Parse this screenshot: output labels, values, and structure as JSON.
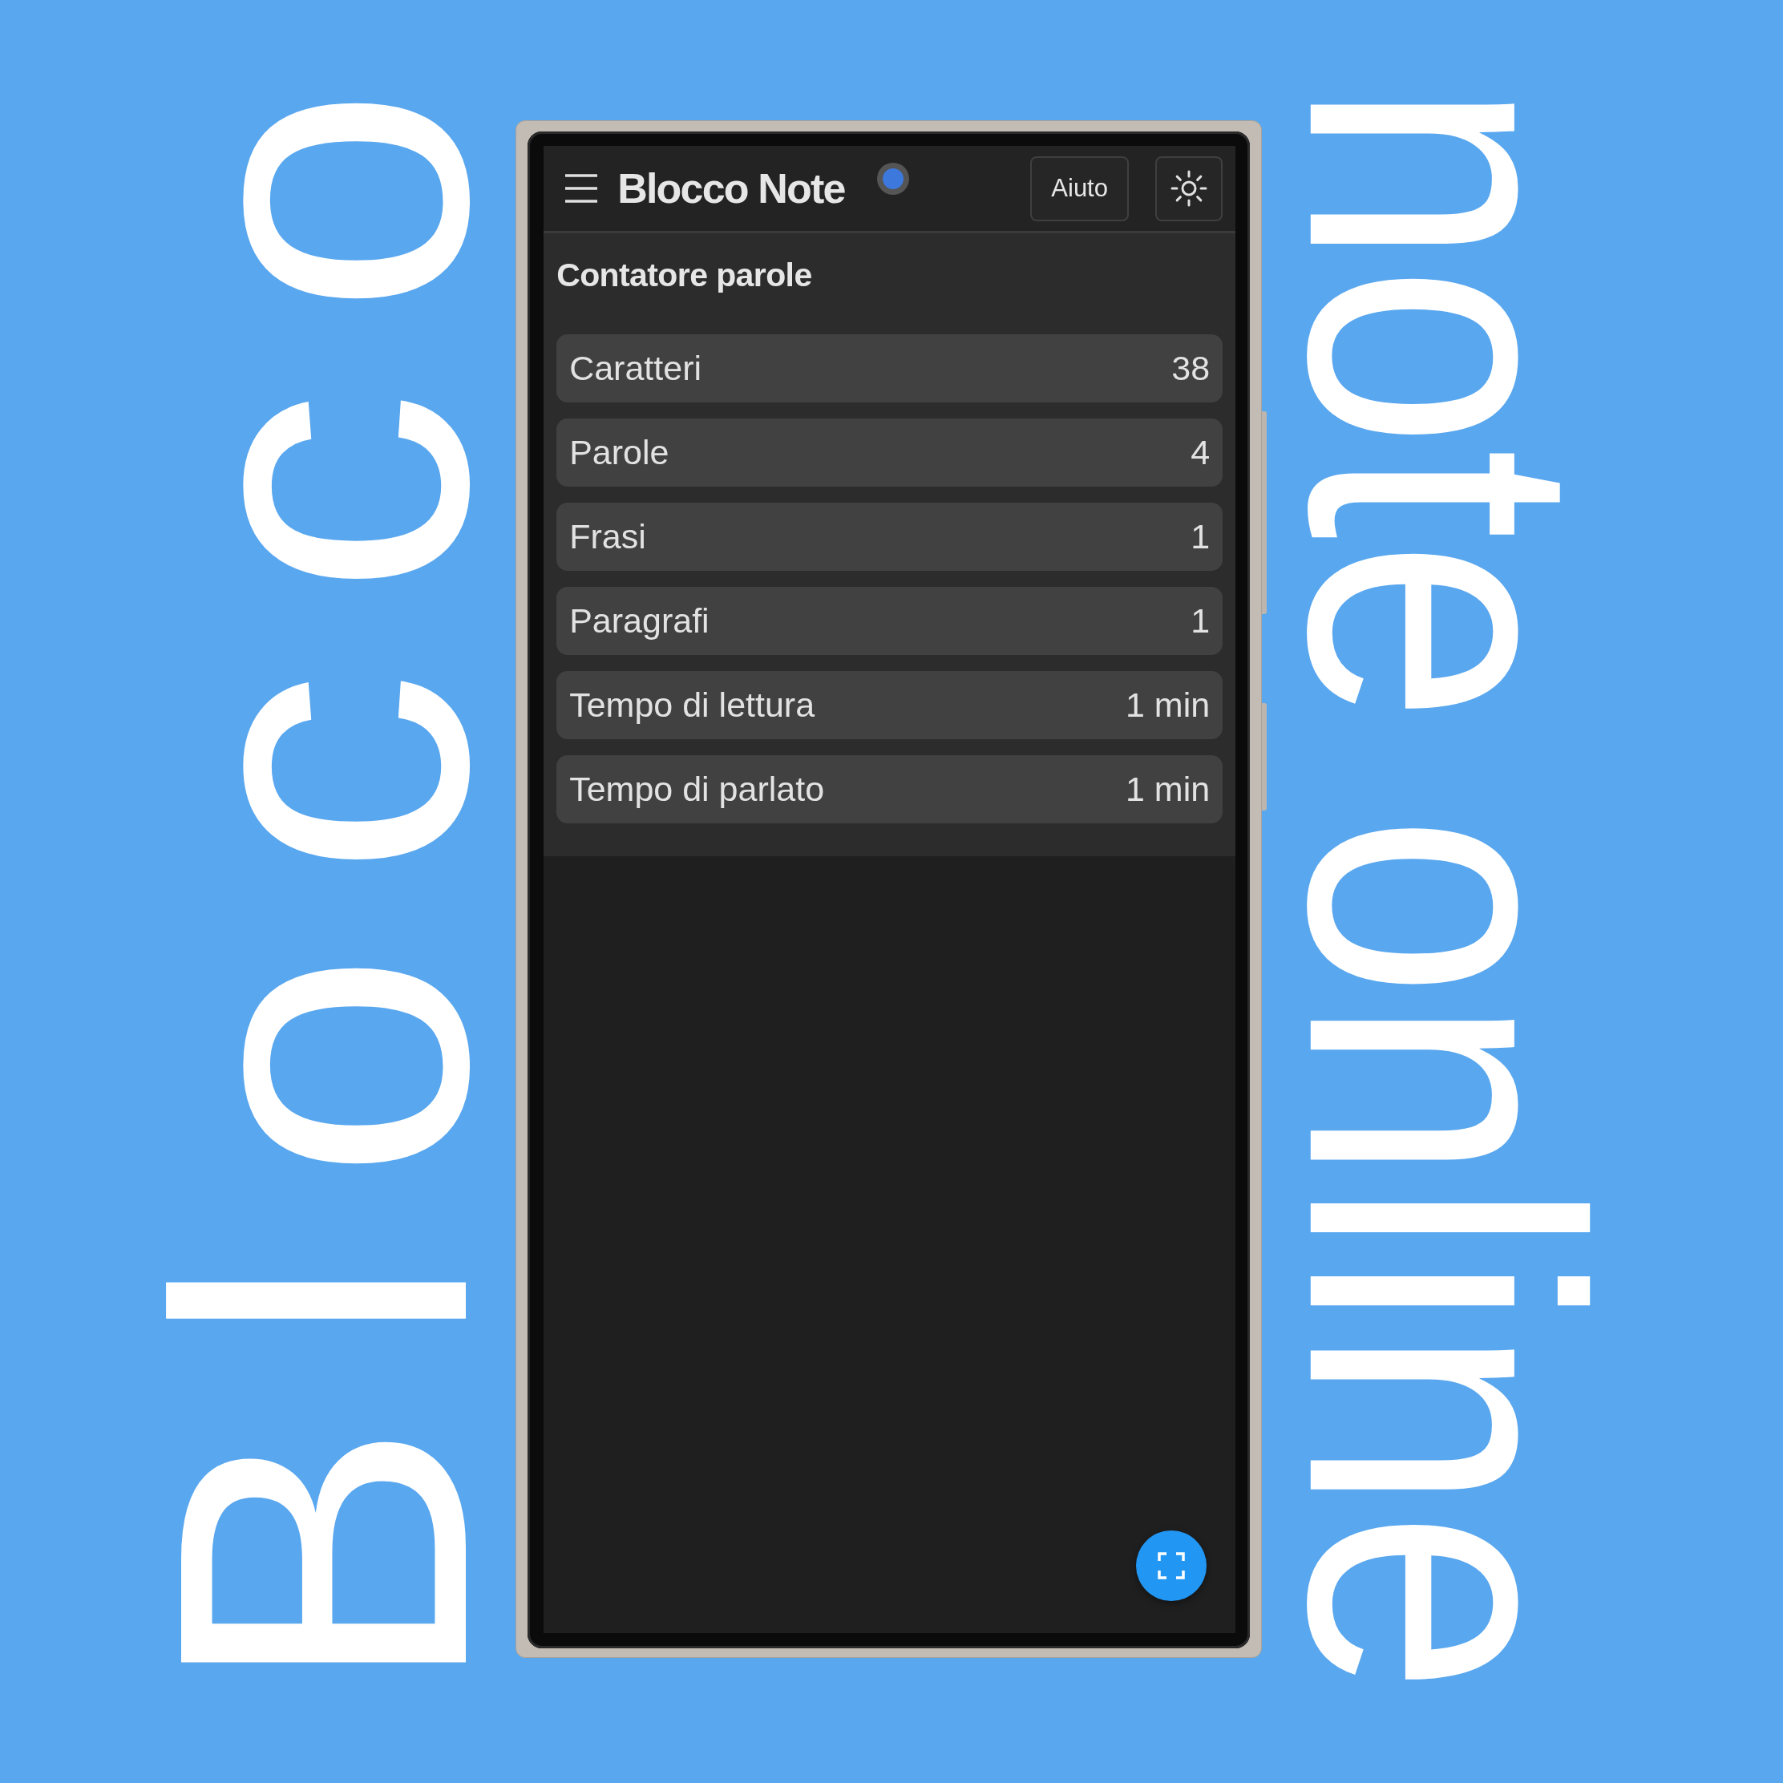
{
  "backdrop": {
    "left_word": "Blocco",
    "right_word": "note online"
  },
  "app_bar": {
    "title": "Blocco Note",
    "help_button": "Aiuto"
  },
  "word_counter": {
    "title": "Contatore parole",
    "stats": [
      {
        "label": "Caratteri",
        "value": "38"
      },
      {
        "label": "Parole",
        "value": "4"
      },
      {
        "label": "Frasi",
        "value": "1"
      },
      {
        "label": "Paragrafi",
        "value": "1"
      },
      {
        "label": "Tempo di lettura",
        "value": "1 min"
      },
      {
        "label": "Tempo di parlato",
        "value": "1 min"
      }
    ]
  }
}
